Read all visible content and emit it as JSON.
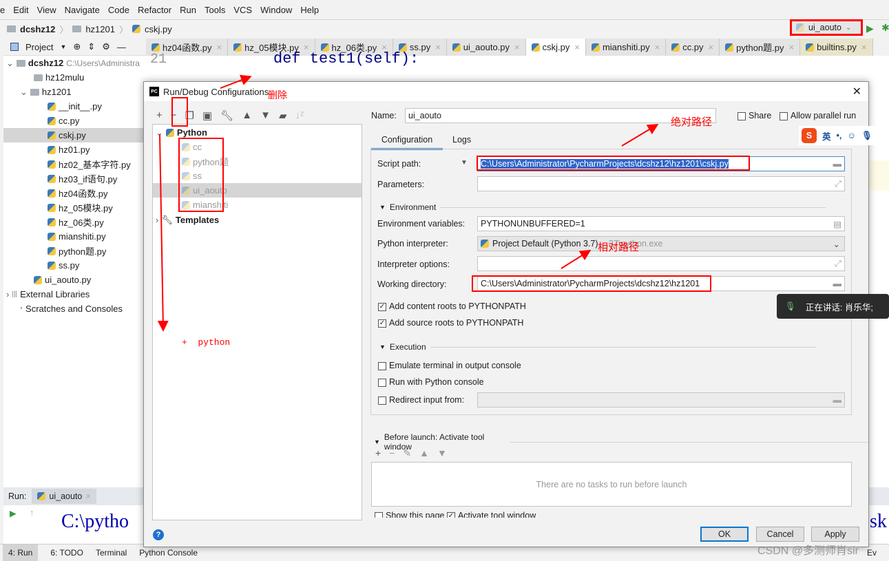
{
  "menu": [
    "e",
    "Edit",
    "View",
    "Navigate",
    "Code",
    "Refactor",
    "Run",
    "Tools",
    "VCS",
    "Window",
    "Help"
  ],
  "breadcrumb": [
    "dcshz12",
    "hz1201",
    "cskj.py"
  ],
  "run_config_selector": "ui_aouto",
  "project_panel": {
    "label": "Project",
    "root": "dcshz12",
    "root_path": "C:\\Users\\Administra",
    "items": [
      {
        "label": "hz12mulu",
        "type": "folder",
        "level": 1
      },
      {
        "label": "hz1201",
        "type": "folder",
        "level": 1,
        "expanded": true
      },
      {
        "label": "__init__.py",
        "level": 2
      },
      {
        "label": "cc.py",
        "level": 2
      },
      {
        "label": "cskj.py",
        "level": 2,
        "selected": true
      },
      {
        "label": "hz01.py",
        "level": 2
      },
      {
        "label": "hz02_基本字符.py",
        "level": 2
      },
      {
        "label": "hz03_if语句.py",
        "level": 2
      },
      {
        "label": "hz04函数.py",
        "level": 2
      },
      {
        "label": "hz_05模块.py",
        "level": 2
      },
      {
        "label": "hz_06类.py",
        "level": 2
      },
      {
        "label": "mianshiti.py",
        "level": 2
      },
      {
        "label": "python题.py",
        "level": 2
      },
      {
        "label": "ss.py",
        "level": 2
      },
      {
        "label": "ui_aouto.py",
        "level": 1
      }
    ],
    "external": "External Libraries",
    "scratches": "Scratches and Consoles"
  },
  "editor_tabs": [
    {
      "label": "hz04函数.py"
    },
    {
      "label": "hz_05模块.py"
    },
    {
      "label": "hz_06类.py"
    },
    {
      "label": "ss.py"
    },
    {
      "label": "ui_aouto.py"
    },
    {
      "label": "cskj.py",
      "active": true
    },
    {
      "label": "mianshiti.py"
    },
    {
      "label": "cc.py"
    },
    {
      "label": "python题.py"
    },
    {
      "label": "builtins.py"
    }
  ],
  "editor": {
    "line_number": "21",
    "code": "def  test1(self):"
  },
  "run_panel": {
    "label": "Run:",
    "tab": "ui_aouto",
    "output": "C:\\pytho",
    "output_right": "sk"
  },
  "status_tabs": [
    "4: Run",
    "6: TODO",
    "Terminal",
    "Python Console",
    "Ev"
  ],
  "dialog": {
    "title": "Run/Debug Configurations",
    "tree": {
      "group": "Python",
      "configs": [
        "cc",
        "python题",
        "ss",
        "ui_aouto",
        "mianshiti"
      ],
      "selected": "ui_aouto",
      "templates": "Templates"
    },
    "name_label": "Name:",
    "name_value": "ui_aouto",
    "share": "Share",
    "allow_parallel": "Allow parallel run",
    "tabs": [
      "Configuration",
      "Logs"
    ],
    "script_path_label": "Script path:",
    "script_path": "C:\\Users\\Administrator\\PycharmProjects\\dcshz12\\hz1201\\cskj.py",
    "parameters_label": "Parameters:",
    "parameters": "",
    "environment_section": "Environment",
    "env_vars_label": "Environment variables:",
    "env_vars": "PYTHONUNBUFFERED=1",
    "interpreter_label": "Python interpreter:",
    "interpreter": "Project Default (Python 3.7)",
    "interpreter_path": "...37\\python.exe",
    "interp_options_label": "Interpreter options:",
    "interp_options": "",
    "working_dir_label": "Working directory:",
    "working_dir": "C:\\Users\\Administrator\\PycharmProjects\\dcshz12\\hz1201",
    "add_content_roots": {
      "label": "Add content roots to PYTHONPATH",
      "checked": true
    },
    "add_source_roots": {
      "label": "Add source roots to PYTHONPATH",
      "checked": true
    },
    "execution_section": "Execution",
    "emulate_terminal": {
      "label": "Emulate terminal in output console",
      "checked": false
    },
    "run_with_console": {
      "label": "Run with Python console",
      "checked": false
    },
    "redirect_input": {
      "label": "Redirect input from:",
      "checked": false
    },
    "before_launch": "Before launch: Activate tool window",
    "no_tasks": "There are no tasks to run before launch",
    "show_page": "Show this page",
    "activate_tool": "Activate tool window",
    "ok": "OK",
    "cancel": "Cancel",
    "apply": "Apply"
  },
  "annotations": {
    "delete": "删除",
    "absolute": "绝对路径",
    "relative": "相对路径",
    "add_python": "+  python"
  },
  "ime": {
    "lang": "英"
  },
  "voice_popup": "正在讲话: 肖乐华;",
  "watermark": "CSDN @多测师肖sir",
  "colors": {
    "accent": "#0078d7",
    "annotation": "#ff0000",
    "selection": "#2f65ca"
  }
}
